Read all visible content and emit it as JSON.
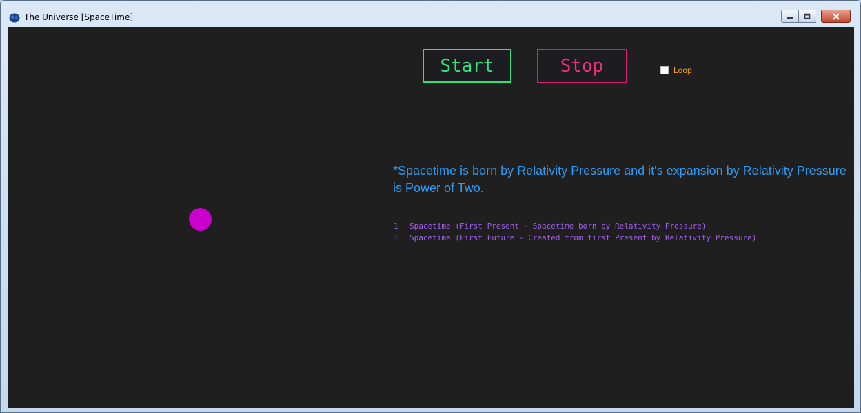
{
  "window": {
    "title": "The Universe [SpaceTime]"
  },
  "controls": {
    "start_label": "Start",
    "stop_label": "Stop",
    "loop_label": "Loop",
    "loop_checked": false
  },
  "headline": "*Spacetime is born by Relativity Pressure and it's expansion by Relativity Pressure is Power of Two.",
  "log": [
    {
      "count": "1",
      "text": "Spacetime (First Present - Spacetime born by Relativity Pressure)"
    },
    {
      "count": "1",
      "text": "Spacetime (First Future - Created from first Present by Relativity Pressure)"
    }
  ],
  "colors": {
    "background": "#1f1f1f",
    "start": "#33e07d",
    "stop": "#e8317a",
    "loop": "#f5a019",
    "headline": "#2d9bf2",
    "log": "#a35ef0",
    "spacetime_dot": "#cc00cc"
  }
}
